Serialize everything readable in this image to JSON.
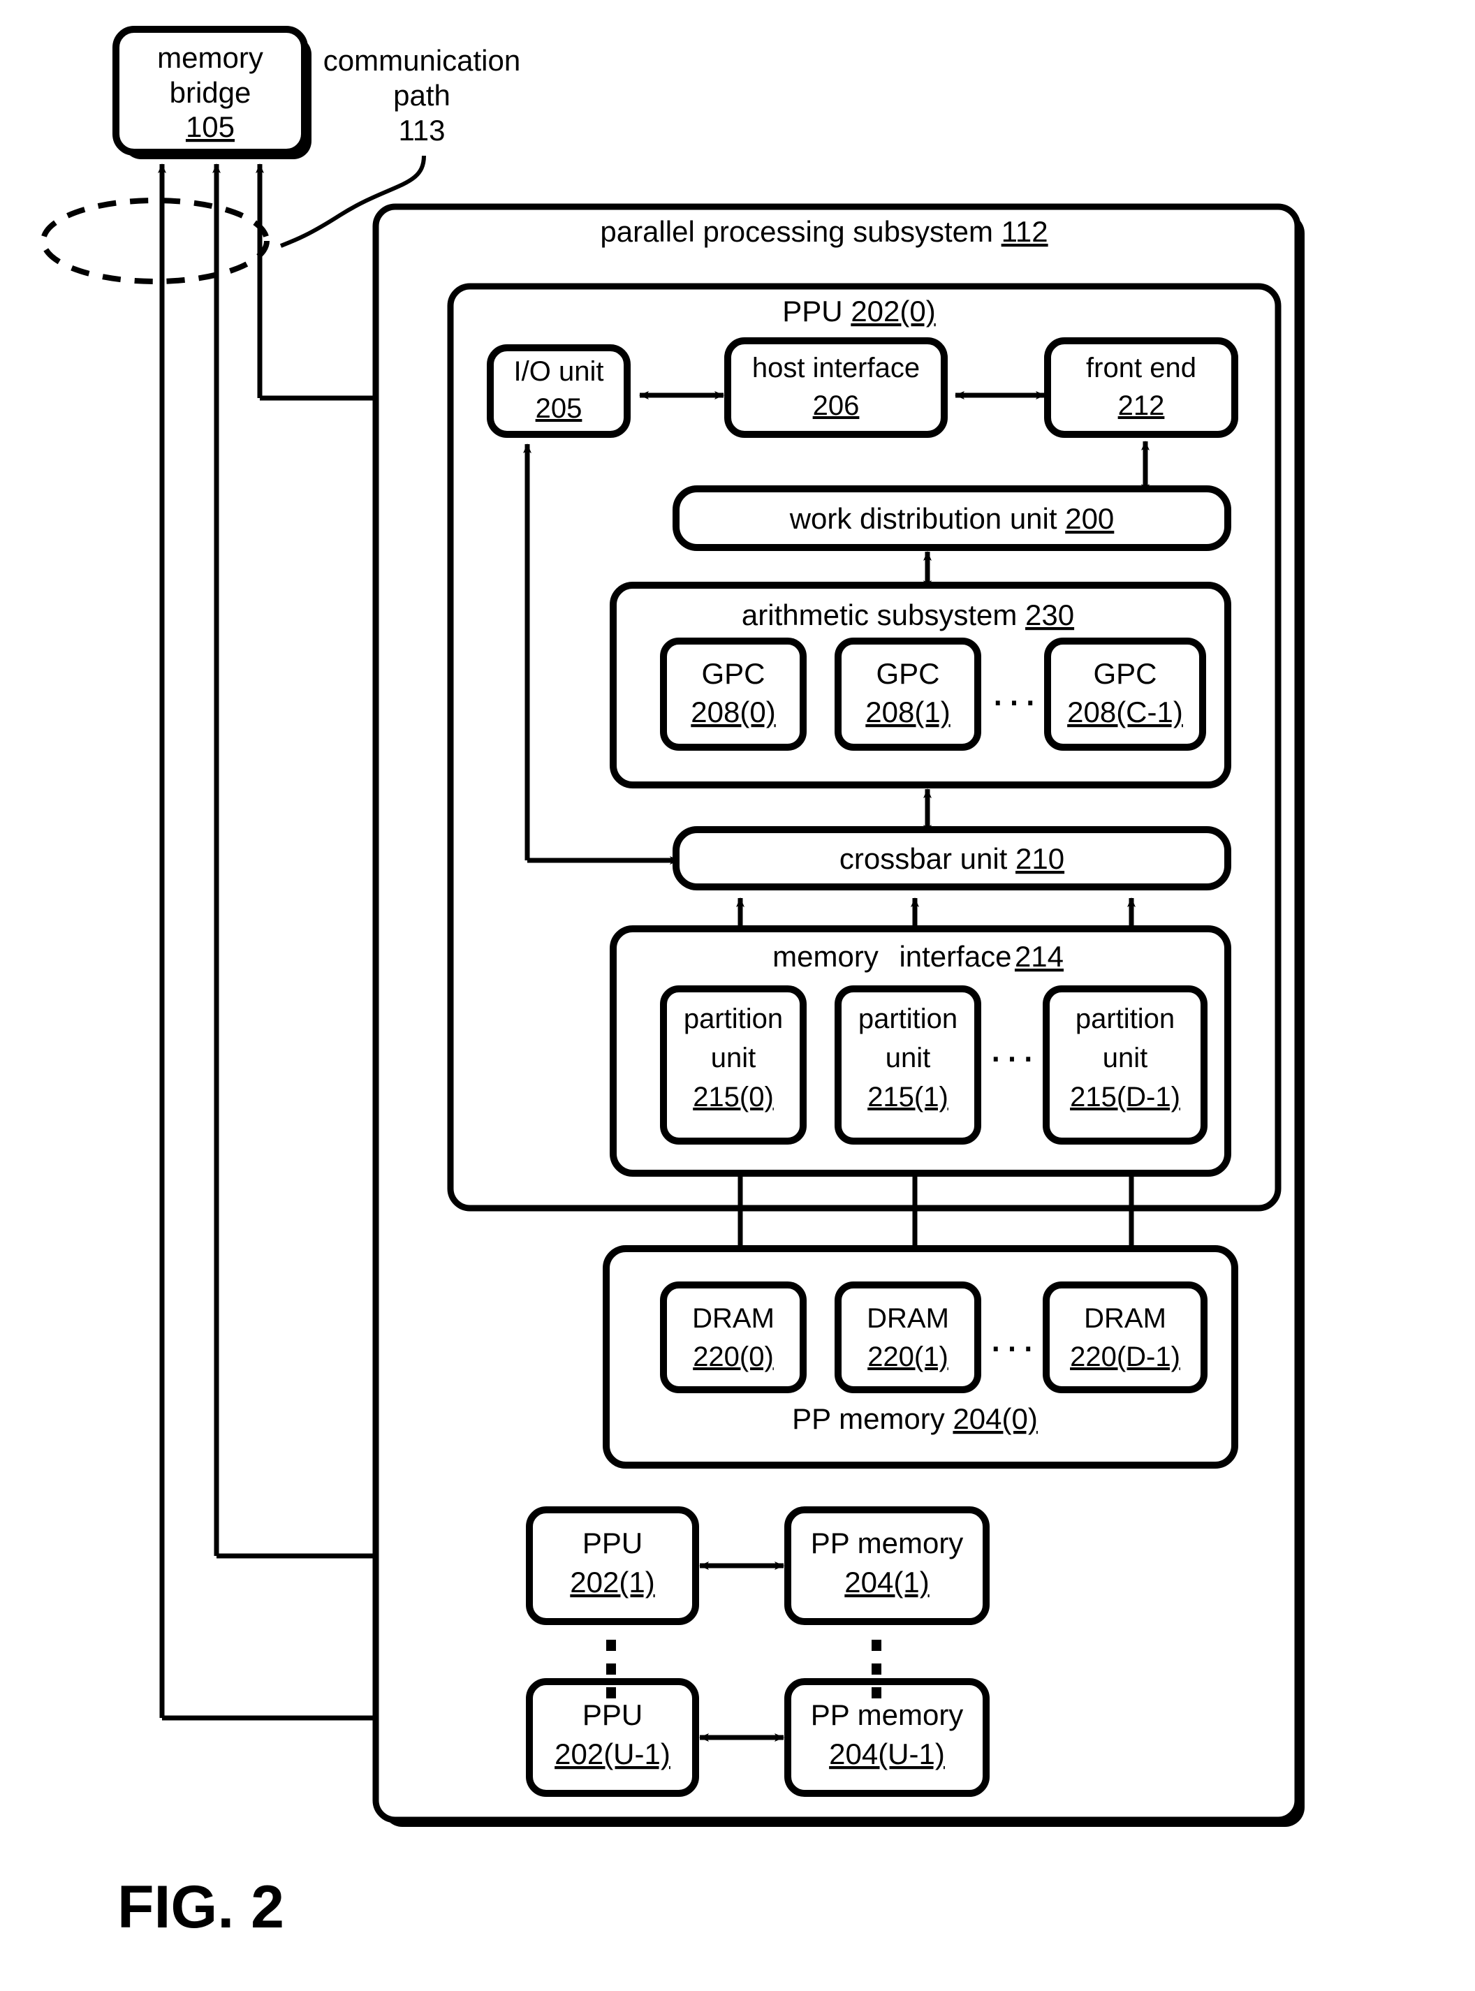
{
  "figure": {
    "caption": "FIG. 2"
  },
  "memory_bridge": {
    "line1": "memory",
    "line2": "bridge",
    "ref": "105"
  },
  "communication_path": {
    "line1": "communication",
    "line2": "path",
    "ref": "113"
  },
  "subsystem": {
    "title": "parallel processing subsystem",
    "ref": "112"
  },
  "ppu0": {
    "title": "PPU",
    "ref": "202(0)"
  },
  "io_unit": {
    "label": "I/O unit",
    "ref": "205"
  },
  "host_interface": {
    "label": "host interface",
    "ref": "206"
  },
  "front_end": {
    "label": "front end",
    "ref": "212"
  },
  "work_distribution": {
    "label": "work distribution unit",
    "ref": "200"
  },
  "arithmetic_subsystem": {
    "title": "arithmetic subsystem",
    "ref": "230",
    "gpcs": [
      {
        "label": "GPC",
        "ref": "208(0)"
      },
      {
        "label": "GPC",
        "ref": "208(1)"
      },
      {
        "label": "GPC",
        "ref": "208(C-1)"
      }
    ],
    "ellipsis": "..."
  },
  "crossbar": {
    "label": "crossbar unit",
    "ref": "210"
  },
  "memory_interface": {
    "title_a": "memory",
    "title_b": "interface",
    "ref": "214",
    "partitions": [
      {
        "l1": "partition",
        "l2": "unit",
        "ref": "215(0)"
      },
      {
        "l1": "partition",
        "l2": "unit",
        "ref": "215(1)"
      },
      {
        "l1": "partition",
        "l2": "unit",
        "ref": "215(D-1)"
      }
    ],
    "ellipsis": "..."
  },
  "pp_memory0": {
    "title": "PP memory",
    "ref": "204(0)",
    "drams": [
      {
        "label": "DRAM",
        "ref": "220(0)"
      },
      {
        "label": "DRAM",
        "ref": "220(1)"
      },
      {
        "label": "DRAM",
        "ref": "220(D-1)"
      }
    ],
    "ellipsis": "..."
  },
  "additional_ppus": [
    {
      "ppu": {
        "title": "PPU",
        "ref": "202(1)"
      },
      "mem": {
        "title": "PP memory",
        "ref": "204(1)"
      }
    },
    {
      "ppu": {
        "title": "PPU",
        "ref": "202(U-1)"
      },
      "mem": {
        "title": "PP memory",
        "ref": "204(U-1)"
      }
    }
  ],
  "colors": {
    "stroke": "#000000",
    "fill": "#ffffff",
    "background": "#ffffff"
  }
}
